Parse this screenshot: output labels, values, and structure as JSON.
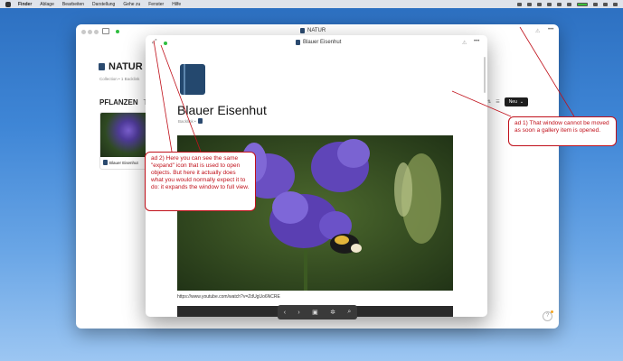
{
  "menubar": {
    "items": [
      "Finder",
      "Ablage",
      "Bearbeiten",
      "Darstellung",
      "Gehe zu",
      "Fenster",
      "Hilfe"
    ]
  },
  "window": {
    "title": "NATUR",
    "collection_title": "NATUR",
    "collection_meta": "Collection  •  1 Backlink",
    "tabs": [
      "PFLANZEN",
      "T"
    ],
    "card_label": "Blauer Eisenhut",
    "new_button": "Neu",
    "help": "?"
  },
  "popup": {
    "title": "Blauer Eisenhut",
    "heading": "Blauer Eisenhut",
    "sub": "Backlink  •",
    "url": "https://www.youtube.com/watch?v=ZdUgUo6NCRE"
  },
  "annotations": {
    "note1": "ad 1) That window cannot be moved as soon a gallery item is opened.",
    "note2": "ad 2) Here you can see the same \"expand\" icon that is used to open objects. But here it actually does what you would normally expect it to do: it expands the window to full view."
  },
  "colors": {
    "annotation_red": "#c0101a",
    "desktop_blue": "#3f86d6",
    "book_blue": "#24486e"
  }
}
